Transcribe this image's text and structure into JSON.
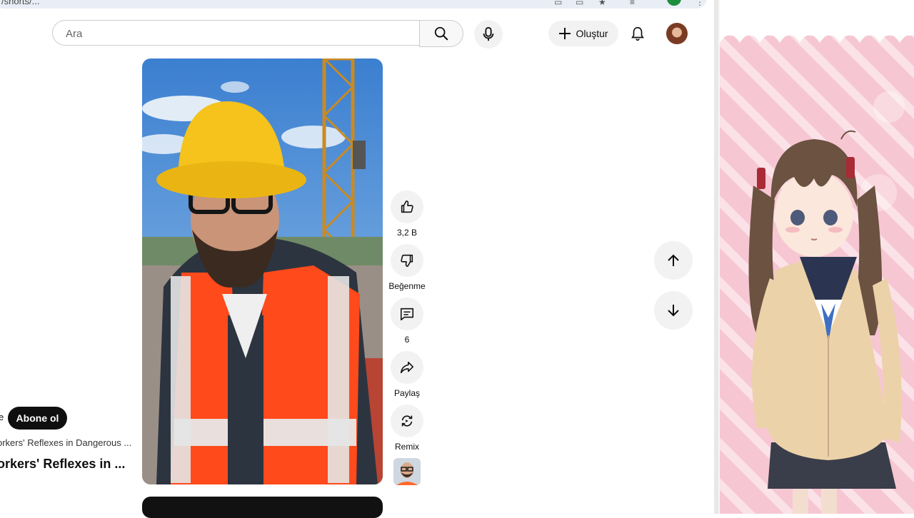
{
  "browser": {
    "url_fragment": "/shorts/...",
    "colors": {
      "profile": "#1e8e3e"
    }
  },
  "header": {
    "search_placeholder": "Ara",
    "create_label": "Oluştur"
  },
  "short": {
    "subscribe_label": "Abone ol",
    "channel_tail": "e",
    "description": "orkers' Reflexes in Dangerous ...",
    "title": "orkers' Reflexes in ..."
  },
  "actions": {
    "like_count": "3,2 B",
    "dislike_label": "Beğenme",
    "comment_count": "6",
    "share_label": "Paylaş",
    "remix_label": "Remix"
  },
  "icons": {
    "search": "search-icon",
    "mic": "microphone-icon",
    "create": "plus-icon",
    "bell": "bell-icon",
    "like": "thumbs-up-icon",
    "dislike": "thumbs-down-icon",
    "comment": "comment-icon",
    "share": "share-icon",
    "remix": "remix-icon",
    "up": "arrow-up-icon",
    "down": "arrow-down-icon"
  }
}
